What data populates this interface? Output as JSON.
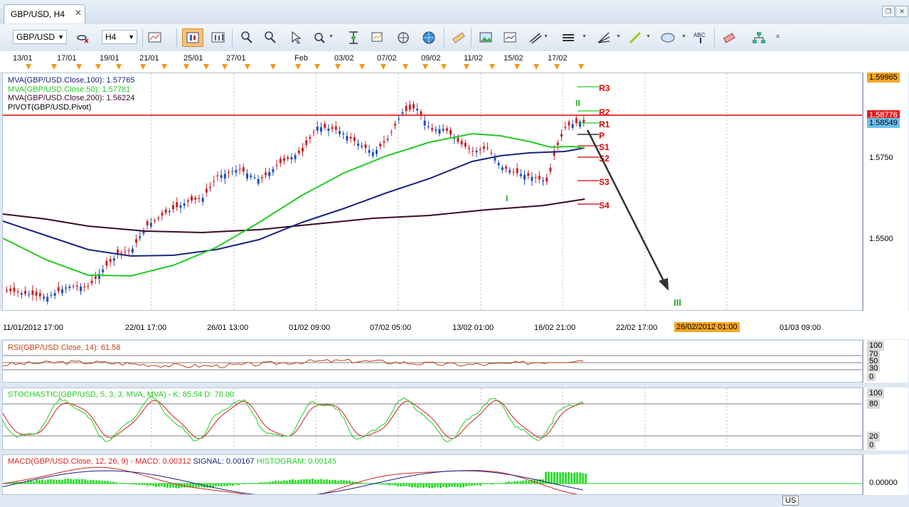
{
  "window": {
    "tab_title": "GBP/USD, H4"
  },
  "toolbar": {
    "symbol": "GBP/USD",
    "timeframe": "H4"
  },
  "top_dates": [
    "13/01",
    "17/01",
    "19/01",
    "21/01",
    "25/01",
    "27/01",
    "Feb",
    "03/02",
    "07/02",
    "09/02",
    "11/02",
    "15/02",
    "17/02"
  ],
  "main": {
    "legend": [
      {
        "text": "MVA(GBP/USD.Close,100): 1.57765",
        "color": "#1a237e"
      },
      {
        "text": "MVA(GBP/USD.Close,50): 1.57781",
        "color": "#22cc22"
      },
      {
        "text": "MVA(GBP/USD.Close,200): 1.56224",
        "color": "#3b0a2a"
      },
      {
        "text": "PIVOT(GBP/USD,Pivot)",
        "color": "#000000"
      }
    ],
    "price_axis": [
      "1.5750",
      "1.5500"
    ],
    "top_price": "1.59965",
    "resistance_price": "1.58776",
    "current_price": "1.58549",
    "pivot_labels": [
      "R3",
      "R2",
      "R1",
      "P",
      "S1",
      "S2",
      "S3",
      "S4"
    ],
    "wave_labels": [
      "I",
      "II",
      "III"
    ]
  },
  "time_axis": {
    "labels": [
      "11/01/2012 17:00",
      "22/01 17:00",
      "26/01 13:00",
      "01/02 09:00",
      "07/02 05:00",
      "13/02 01:00",
      "16/02 21:00",
      "22/02 17:00",
      "01/03 09:00"
    ],
    "highlight": "26/02/2012 01:00"
  },
  "rsi": {
    "label": "RSI(GBP/USD.Close, 14): 61.58",
    "axis": [
      "100",
      "70",
      "50",
      "30",
      "0"
    ]
  },
  "stochastic": {
    "label": "STOCHASTIC(GBP/USD, 5, 3, 3, MVA, MVA) -  K: 85.54  D: 78.00",
    "axis": [
      "100",
      "80",
      "20",
      "0"
    ]
  },
  "macd": {
    "label_name": "MACD(GBP/USD.Close, 12, 26, 9) - ",
    "label_macd": "MACD: 0.00312",
    "label_signal": "SIGNAL: 0.00167",
    "label_hist": "HISTOGRAM: 0.00145",
    "axis": [
      "0.00000"
    ]
  },
  "status": {
    "lang": "US"
  },
  "colors": {
    "up_candle": "#1f4fbf",
    "down_candle": "#d02020",
    "resistance": "#e00000",
    "arrow": "#333333"
  }
}
